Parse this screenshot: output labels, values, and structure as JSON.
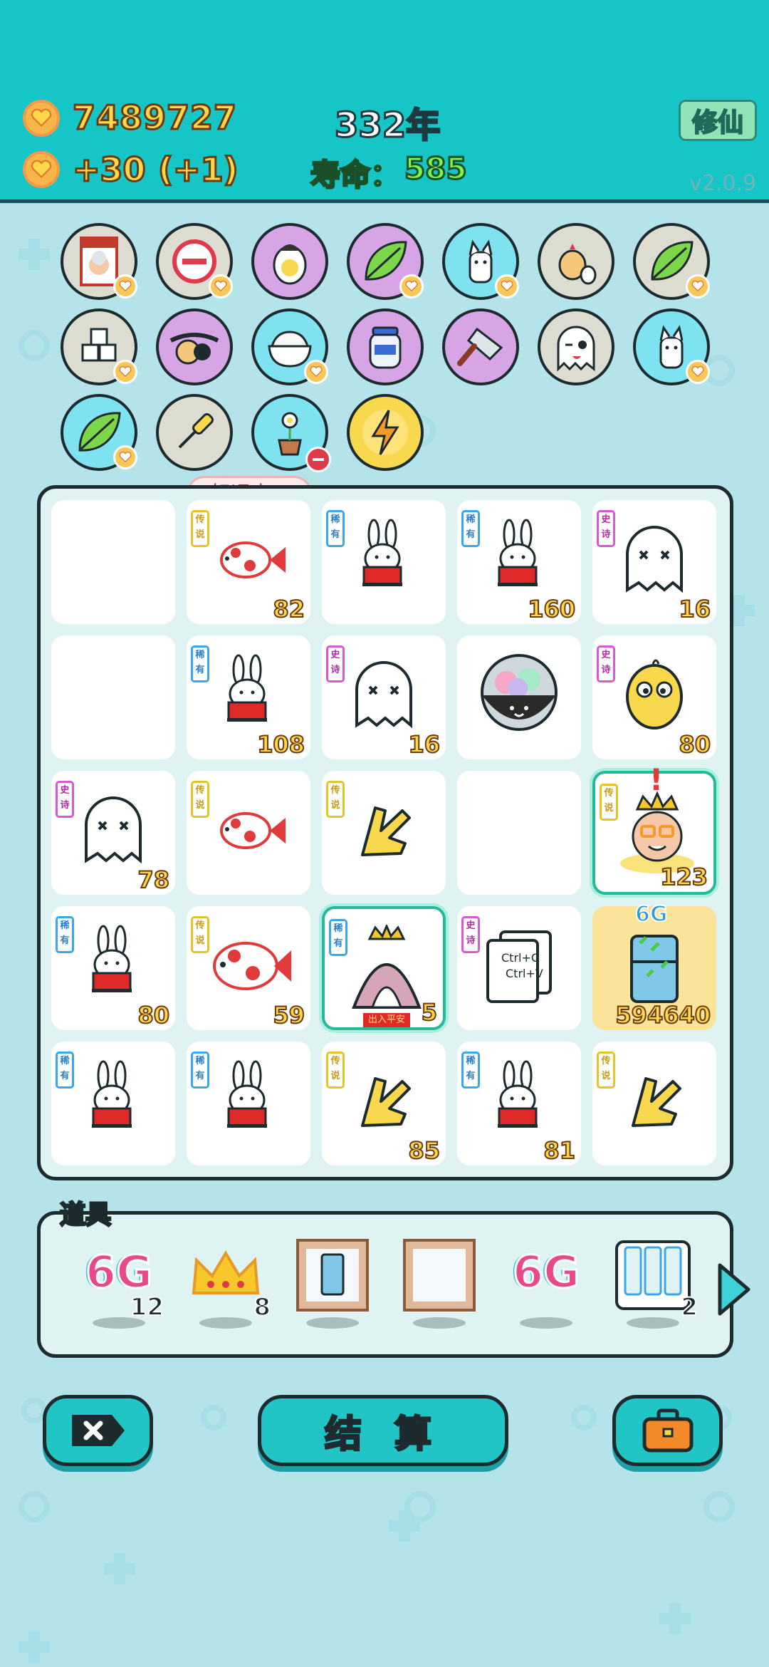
{
  "header": {
    "money": "7489727",
    "income": "+30",
    "income_bonus": "(+1)",
    "year": "332年",
    "life_label": "寿命：",
    "life_value": "585",
    "xiuxian_label": "修仙",
    "version": "v2.0.9"
  },
  "skills": [
    {
      "icon": "time-magazine-icon",
      "bg": "grey",
      "badge": "heart"
    },
    {
      "icon": "no-entry-icon",
      "bg": "grey",
      "badge": "heart"
    },
    {
      "icon": "egg-icon",
      "bg": "purple",
      "badge": "none"
    },
    {
      "icon": "leaf-icon",
      "bg": "purple",
      "badge": "heart"
    },
    {
      "icon": "husky-dog-icon",
      "bg": "blue",
      "badge": "heart"
    },
    {
      "icon": "chicken-egg-icon",
      "bg": "grey",
      "badge": "none"
    },
    {
      "icon": "leaf-icon",
      "bg": "grey",
      "badge": "heart"
    },
    {
      "icon": "sugar-cubes-icon",
      "bg": "grey",
      "badge": "heart"
    },
    {
      "icon": "eyepatch-icon",
      "bg": "purple",
      "badge": "none"
    },
    {
      "icon": "rice-bowl-icon",
      "bg": "blue",
      "badge": "heart"
    },
    {
      "icon": "jar-icon",
      "bg": "purple",
      "badge": "none"
    },
    {
      "icon": "cleaver-icon",
      "bg": "purple",
      "badge": "none"
    },
    {
      "icon": "winking-ghost-icon",
      "bg": "grey",
      "badge": "none"
    },
    {
      "icon": "husky-dog-icon",
      "bg": "blue",
      "badge": "heart"
    },
    {
      "icon": "leaf-icon",
      "bg": "blue",
      "badge": "heart"
    },
    {
      "icon": "screwdriver-icon",
      "bg": "grey",
      "badge": "none"
    },
    {
      "icon": "flower-pot-icon",
      "bg": "blue",
      "badge": "minus"
    },
    {
      "icon": "lightning-icon",
      "bg": "yellow",
      "badge": "none"
    }
  ],
  "bubble": "好运来~",
  "rarity_labels": {
    "legend": "传说",
    "rare": "稀有",
    "epic": "史诗"
  },
  "board": [
    {
      "item": "empty",
      "rarity": "",
      "count": ""
    },
    {
      "item": "fish-icon",
      "rarity": "legend",
      "count": "82"
    },
    {
      "item": "rabbit-icon",
      "rarity": "rare",
      "count": ""
    },
    {
      "item": "rabbit-icon",
      "rarity": "rare",
      "count": "160"
    },
    {
      "item": "ghost-icon",
      "rarity": "epic",
      "count": "16"
    },
    {
      "item": "empty",
      "rarity": "",
      "count": ""
    },
    {
      "item": "rabbit-icon",
      "rarity": "rare",
      "count": "108"
    },
    {
      "item": "ghost-icon",
      "rarity": "epic",
      "count": "16"
    },
    {
      "item": "gacha-ball-icon",
      "rarity": "",
      "count": ""
    },
    {
      "item": "yellow-face-icon",
      "rarity": "epic",
      "count": "80"
    },
    {
      "item": "ghost-icon",
      "rarity": "epic",
      "count": "78"
    },
    {
      "item": "fish-icon",
      "rarity": "legend",
      "count": ""
    },
    {
      "item": "yellow-hand-icon",
      "rarity": "legend",
      "count": ""
    },
    {
      "item": "empty",
      "rarity": "",
      "count": ""
    },
    {
      "item": "king-face-icon",
      "rarity": "legend",
      "count": "123"
    },
    {
      "item": "rabbit-icon",
      "rarity": "rare",
      "count": "80"
    },
    {
      "item": "big-fish-icon",
      "rarity": "legend",
      "count": "59"
    },
    {
      "item": "tent-icon",
      "rarity": "rare",
      "count": "5"
    },
    {
      "item": "copy-paste-icon",
      "rarity": "epic",
      "count": ""
    },
    {
      "item": "fridge-icon",
      "rarity": "",
      "count": "594640",
      "label": "6G"
    },
    {
      "item": "rabbit-icon",
      "rarity": "rare",
      "count": ""
    },
    {
      "item": "rabbit-icon",
      "rarity": "rare",
      "count": ""
    },
    {
      "item": "yellow-hand-icon",
      "rarity": "legend",
      "count": "85"
    },
    {
      "item": "rabbit-icon",
      "rarity": "rare",
      "count": "81"
    },
    {
      "item": "yellow-hand-icon",
      "rarity": "legend",
      "count": ""
    }
  ],
  "copy_paste": {
    "line1": "Ctrl+C",
    "line2": "Ctrl+V"
  },
  "tent_banner": "出入平安",
  "alert_mark": "!",
  "props": {
    "title": "道具",
    "items": [
      {
        "icon": "6g-icon",
        "label": "6G",
        "count": "12"
      },
      {
        "icon": "crown-icon",
        "label": "",
        "count": "8"
      },
      {
        "icon": "fridge-frame-icon",
        "label": "",
        "count": ""
      },
      {
        "icon": "empty-frame-icon",
        "label": "",
        "count": ""
      },
      {
        "icon": "6g-icon",
        "label": "6G",
        "count": ""
      },
      {
        "icon": "rarity-cards-icon",
        "label": "",
        "count": "2"
      }
    ]
  },
  "buttons": {
    "settle_label": "结 算"
  },
  "colors": {
    "header": "#16c6c6",
    "accent": "#22c5c5",
    "gold_text": "#ffd84a",
    "life_text": "#7cf54a"
  }
}
